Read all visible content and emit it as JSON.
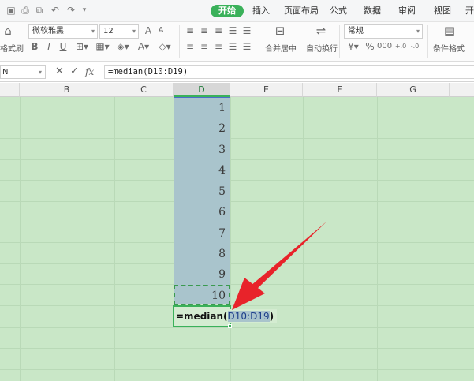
{
  "menubar": {
    "tabs": [
      "开始",
      "插入",
      "页面布局",
      "公式",
      "数据",
      "审阅",
      "视图",
      "开发"
    ],
    "active_tab": "开始"
  },
  "ribbon": {
    "format_painter_label": "格式刷",
    "font_name": "微软雅黑",
    "font_size": "12",
    "merge_center_label": "合并居中",
    "wrap_text_label": "自动换行",
    "number_format": "常规",
    "conditional_format_label": "条件格式"
  },
  "formula_bar": {
    "name_box": "N",
    "fx_label": "fx",
    "formula": "=median(D10:D19)"
  },
  "grid": {
    "columns": [
      "B",
      "C",
      "D",
      "E",
      "F",
      "G"
    ],
    "selected_column": "D",
    "values": [
      "1",
      "2",
      "3",
      "4",
      "5",
      "6",
      "7",
      "8",
      "9",
      "10"
    ],
    "editing": {
      "func": "=median(",
      "ref": "D10:D19",
      "close": ")"
    }
  },
  "colors": {
    "accent": "#3ab15a",
    "sheet_background": "#c9e7c7",
    "selection_fill": "#a9c4cc",
    "annotation_arrow": "#e8232a"
  }
}
